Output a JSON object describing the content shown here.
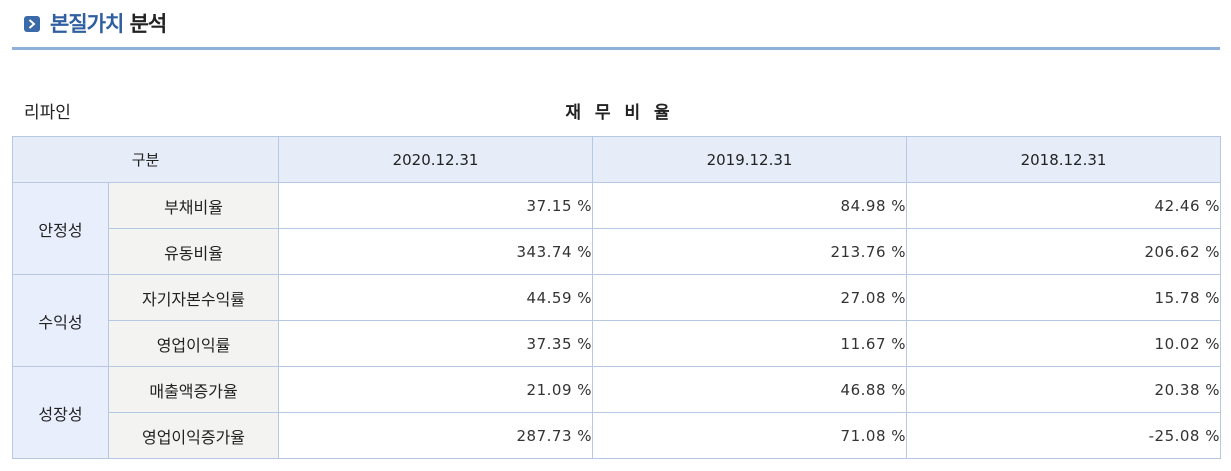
{
  "header": {
    "title_highlight": "본질가치",
    "title_rest": "분석"
  },
  "company": "리파인",
  "caption": "재 무 비 율",
  "table": {
    "header_label": "구분",
    "columns": [
      "2020.12.31",
      "2019.12.31",
      "2018.12.31"
    ],
    "groups": [
      {
        "label": "안정성",
        "rows": [
          {
            "label": "부채비율",
            "values": [
              "37.15 %",
              "84.98 %",
              "42.46 %"
            ]
          },
          {
            "label": "유동비율",
            "values": [
              "343.74 %",
              "213.76 %",
              "206.62 %"
            ]
          }
        ]
      },
      {
        "label": "수익성",
        "rows": [
          {
            "label": "자기자본수익률",
            "values": [
              "44.59 %",
              "27.08 %",
              "15.78 %"
            ]
          },
          {
            "label": "영업이익률",
            "values": [
              "37.35 %",
              "11.67 %",
              "10.02 %"
            ]
          }
        ]
      },
      {
        "label": "성장성",
        "rows": [
          {
            "label": "매출액증가율",
            "values": [
              "21.09 %",
              "46.88 %",
              "20.38 %"
            ]
          },
          {
            "label": "영업이익증가율",
            "values": [
              "287.73 %",
              "71.08 %",
              "-25.08 %"
            ]
          }
        ]
      }
    ]
  }
}
